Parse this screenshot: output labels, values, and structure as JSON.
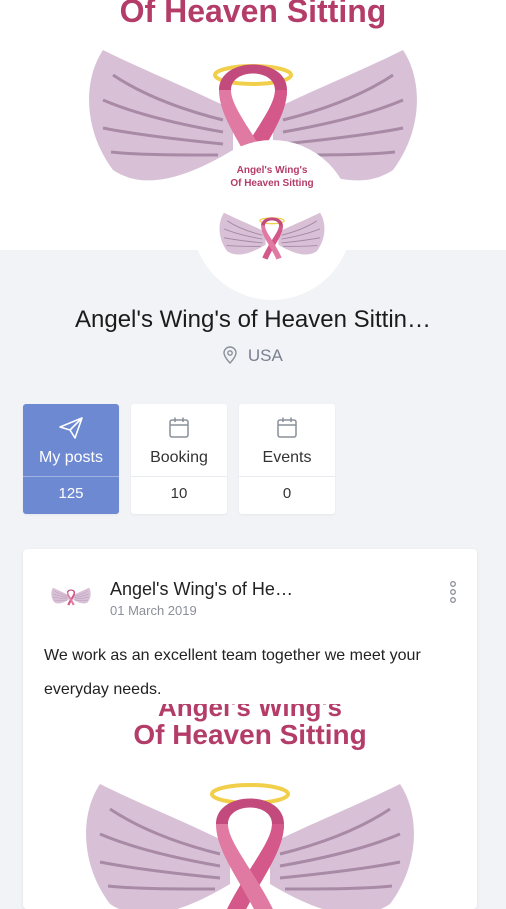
{
  "cover": {
    "logo_text": "Of Heaven Sitting"
  },
  "avatar": {
    "line1": "Angel's Wing's",
    "line2": "Of Heaven Sitting"
  },
  "profile": {
    "name": "Angel's Wing's of Heaven Sittin…",
    "location": "USA",
    "location_icon": "location-pin-icon"
  },
  "stats": [
    {
      "label": "My posts",
      "count": "125",
      "icon": "paper-plane-icon",
      "active": true
    },
    {
      "label": "Booking",
      "count": "10",
      "icon": "calendar-icon",
      "active": false
    },
    {
      "label": "Events",
      "count": "0",
      "icon": "calendar-icon",
      "active": false
    }
  ],
  "post": {
    "author": "Angel's Wing's of He…",
    "date": "01 March 2019",
    "text": "We work as an excellent team together we meet your everyday needs.",
    "image_top_text": "Angel's Wing's",
    "image_text": "Of Heaven Sitting"
  },
  "colors": {
    "accent": "#6d89d2",
    "brand_pink": "#b43c68",
    "ribbon": "#d4588a",
    "halo": "#f2cf4a",
    "wing": "#c9adc6"
  }
}
